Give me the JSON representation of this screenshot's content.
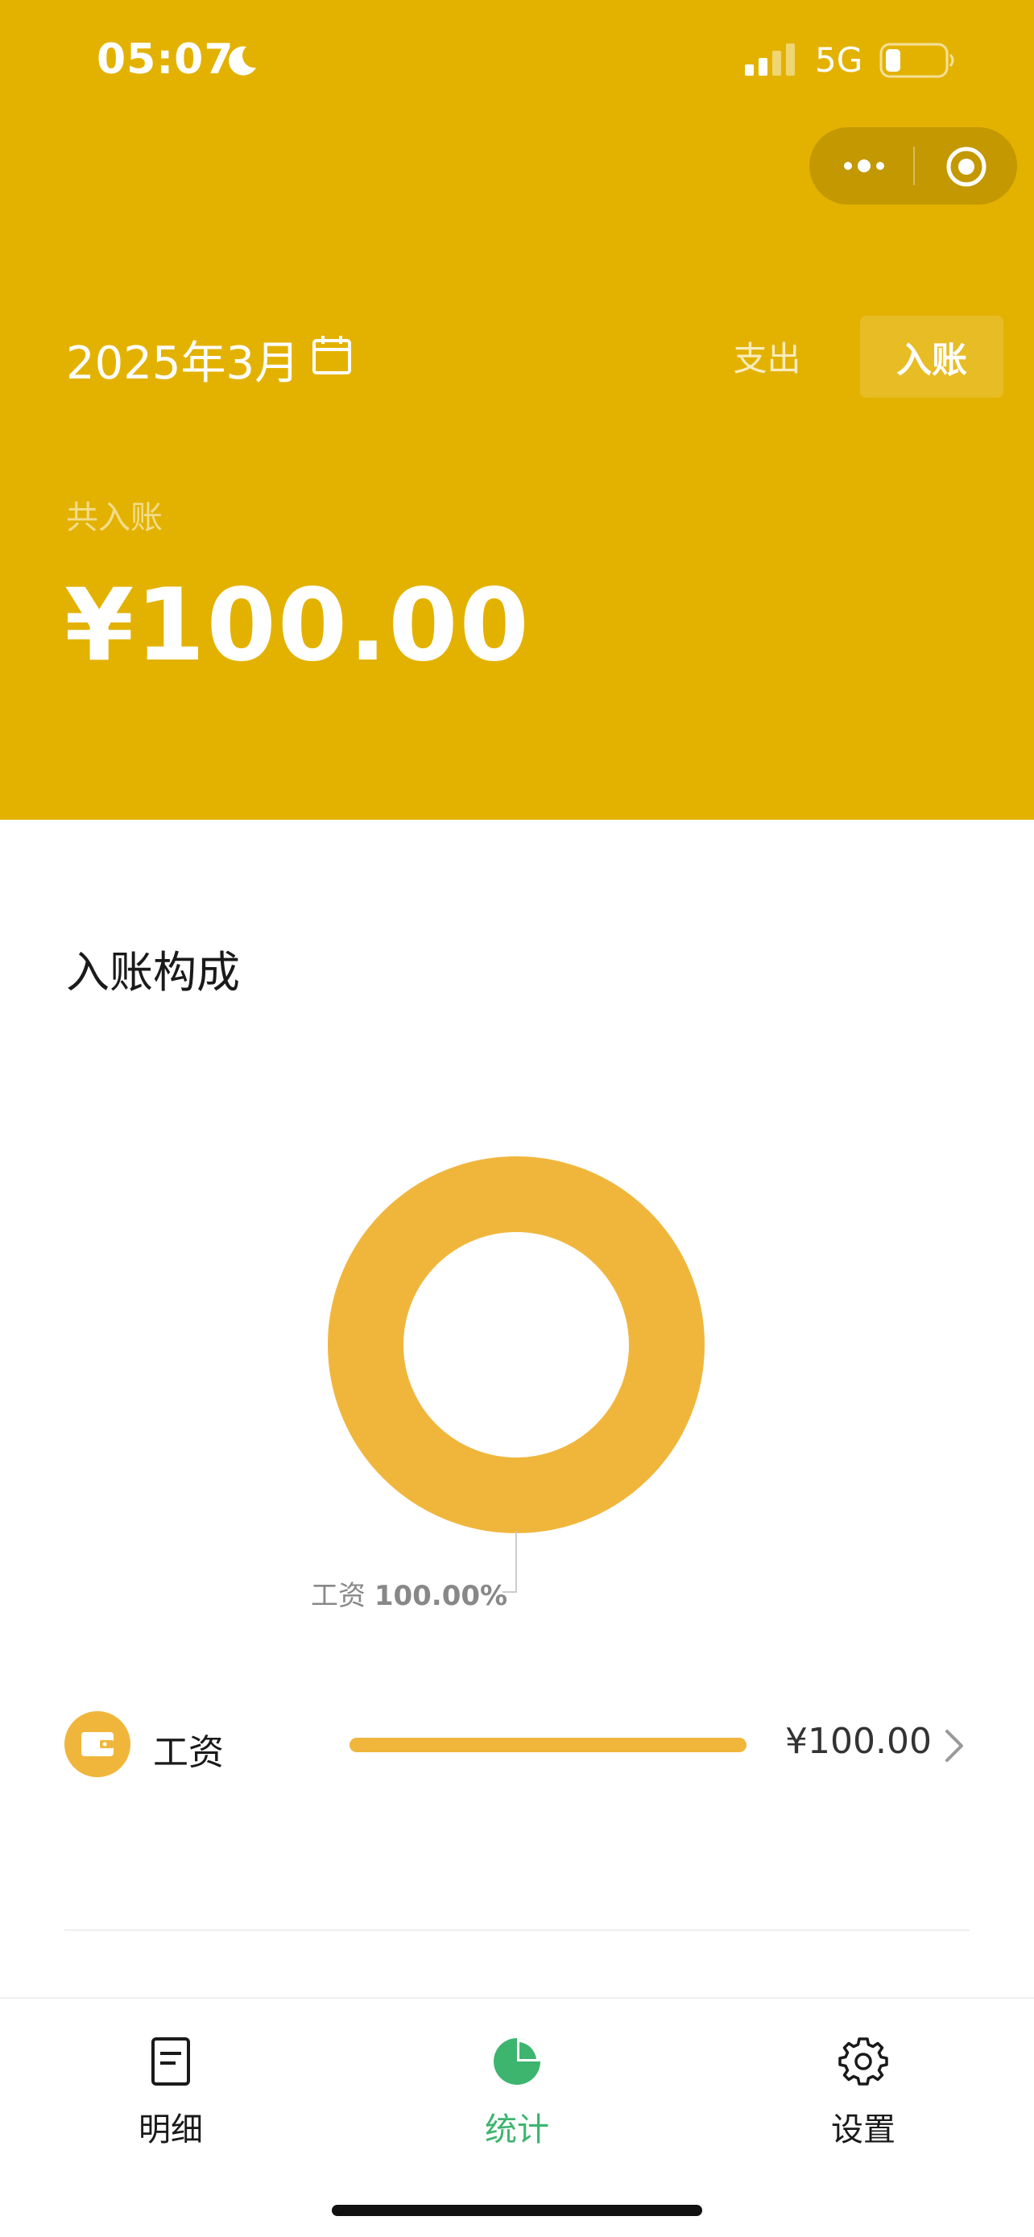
{
  "status_bar": {
    "time": "05:07",
    "network": "5G"
  },
  "header": {
    "month": "2025年3月",
    "tabs": {
      "expense": "支出",
      "income": "入账"
    },
    "total_label": "共入账",
    "total_amount": "¥100.00"
  },
  "composition": {
    "title": "入账构成",
    "chart_label_name": "工资",
    "chart_label_percent": "100.00%",
    "chart_color": "#F0B63C"
  },
  "categories": [
    {
      "name": "工资",
      "amount": "¥100.00",
      "share": 1.0,
      "icon": "wallet-icon"
    }
  ],
  "chart_data": {
    "type": "pie",
    "categories": [
      "工资"
    ],
    "values": [
      100.0
    ],
    "labels": [
      "工资 100.00%"
    ],
    "colors": [
      "#F0B63C"
    ]
  },
  "tabbar": {
    "items": [
      {
        "label": "明细",
        "icon": "document-icon"
      },
      {
        "label": "统计",
        "icon": "pie-chart-icon",
        "active": true
      },
      {
        "label": "设置",
        "icon": "gear-icon"
      }
    ]
  },
  "colors": {
    "header_bg": "#E3B200",
    "accent": "#F0B63C",
    "active_tab": "#3DB56E"
  }
}
